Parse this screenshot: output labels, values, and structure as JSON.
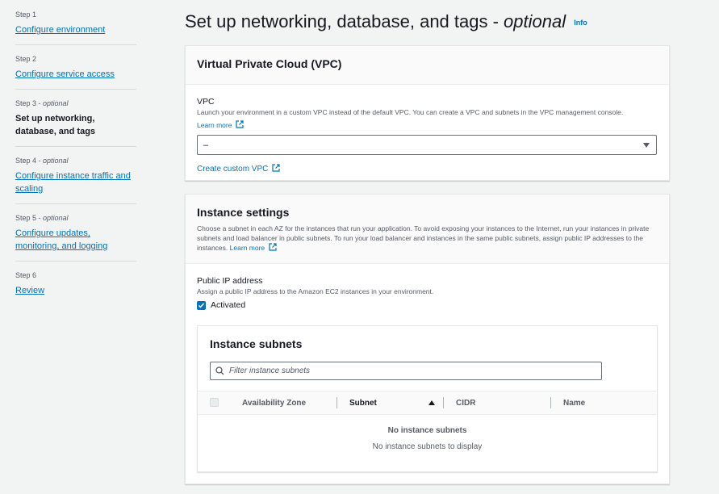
{
  "sidebar": {
    "steps": [
      {
        "num": "Step 1",
        "label": "Configure environment"
      },
      {
        "num": "Step 2",
        "label": "Configure service access"
      },
      {
        "num": "Step 3",
        "opt": "optional",
        "label": "Set up networking, database, and tags"
      },
      {
        "num": "Step 4",
        "opt": "optional",
        "label": "Configure instance traffic and scaling"
      },
      {
        "num": "Step 5",
        "opt": "optional",
        "label": "Configure updates, monitoring, and logging"
      },
      {
        "num": "Step 6",
        "label": "Review"
      }
    ]
  },
  "page": {
    "title_main": "Set up networking, database, and tags - ",
    "title_optional": "optional",
    "info": "Info"
  },
  "vpc_panel": {
    "title": "Virtual Private Cloud (VPC)",
    "field_label": "VPC",
    "field_desc": "Launch your environment in a custom VPC instead of the default VPC. You can create a VPC and subnets in the VPC management console.",
    "learn_more": "Learn more",
    "select_value": "–",
    "create_link": "Create custom VPC"
  },
  "instance_panel": {
    "title": "Instance settings",
    "desc": "Choose a subnet in each AZ for the instances that run your application. To avoid exposing your instances to the Internet, run your instances in private subnets and load balancer in public subnets. To run your load balancer and instances in the same public subnets, assign public IP addresses to the instances.",
    "learn_more": "Learn more",
    "public_ip_label": "Public IP address",
    "public_ip_desc": "Assign a public IP address to the Amazon EC2 instances in your environment.",
    "activated_label": "Activated",
    "activated_checked": true
  },
  "subnets": {
    "title": "Instance subnets",
    "filter_placeholder": "Filter instance subnets",
    "columns": [
      "Availability Zone",
      "Subnet",
      "CIDR",
      "Name"
    ],
    "empty_title": "No instance subnets",
    "empty_desc": "No instance subnets to display"
  },
  "colors": {
    "accent": "#0073bb",
    "background": "#f2f3f3"
  }
}
